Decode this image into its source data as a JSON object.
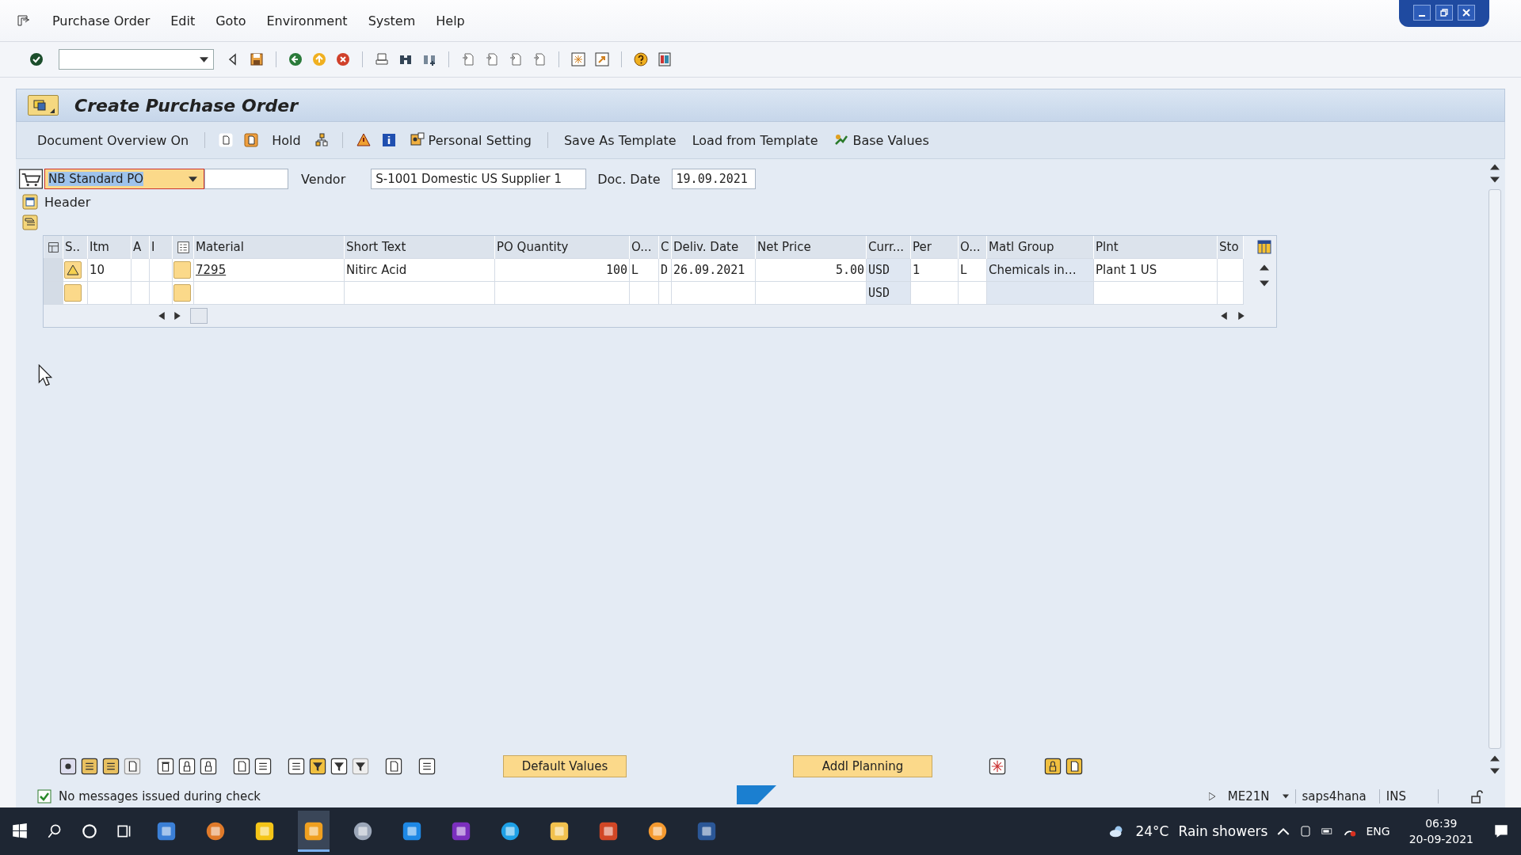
{
  "menu": [
    "Purchase Order",
    "Edit",
    "Goto",
    "Environment",
    "System",
    "Help"
  ],
  "title": "Create Purchase Order",
  "app_toolbar": {
    "overview": "Document Overview On",
    "hold": "Hold",
    "personal": "Personal Setting",
    "save_template": "Save As Template",
    "load_template": "Load from Template",
    "base_values": "Base Values"
  },
  "form": {
    "doc_type": "NB Standard PO",
    "vendor_label": "Vendor",
    "vendor": "S-1001 Domestic US Supplier 1",
    "date_label": "Doc. Date",
    "date": "19.09.2021",
    "header_label": "Header"
  },
  "table": {
    "columns": [
      {
        "kind": "selector"
      },
      {
        "kind": "status",
        "label": "S.."
      },
      {
        "kind": "text",
        "label": "Itm"
      },
      {
        "kind": "text",
        "label": "A"
      },
      {
        "kind": "text",
        "label": "I"
      },
      {
        "kind": "icon"
      },
      {
        "kind": "link",
        "label": "Material"
      },
      {
        "kind": "text",
        "label": "Short Text"
      },
      {
        "kind": "number",
        "label": "PO Quantity"
      },
      {
        "kind": "text",
        "label": "O..."
      },
      {
        "kind": "mono",
        "label": "C"
      },
      {
        "kind": "mono",
        "label": "Deliv. Date"
      },
      {
        "kind": "number",
        "label": "Net Price"
      },
      {
        "kind": "readonly",
        "label": "Curr..."
      },
      {
        "kind": "text",
        "label": "Per"
      },
      {
        "kind": "text",
        "label": "O..."
      },
      {
        "kind": "shaded",
        "label": "Matl Group"
      },
      {
        "kind": "text",
        "label": "Plnt"
      },
      {
        "kind": "text",
        "label": "Sto"
      }
    ],
    "rows": [
      {
        "warning": true,
        "cells": [
          null,
          null,
          "10",
          null,
          null,
          null,
          "7295",
          "Nitirc Acid",
          "100",
          "L",
          "D",
          "26.09.2021",
          "5.00",
          "USD",
          "1",
          "L",
          "Chemicals in…",
          "Plant 1 US",
          null
        ]
      },
      {
        "warning": false,
        "cells": [
          null,
          null,
          null,
          null,
          null,
          null,
          null,
          null,
          null,
          null,
          null,
          null,
          null,
          "USD",
          null,
          null,
          null,
          null,
          null
        ]
      }
    ]
  },
  "bottom_buttons": [
    "Default Values",
    "Addl Planning"
  ],
  "status_bar": {
    "message": "No messages issued during check",
    "transaction": "ME21N",
    "system": "saps4hana",
    "mode": "INS"
  },
  "taskbar": {
    "temperature": "24°C",
    "weather": "Rain showers",
    "language": "ENG",
    "time": "06:39",
    "date": "20-09-2021"
  }
}
